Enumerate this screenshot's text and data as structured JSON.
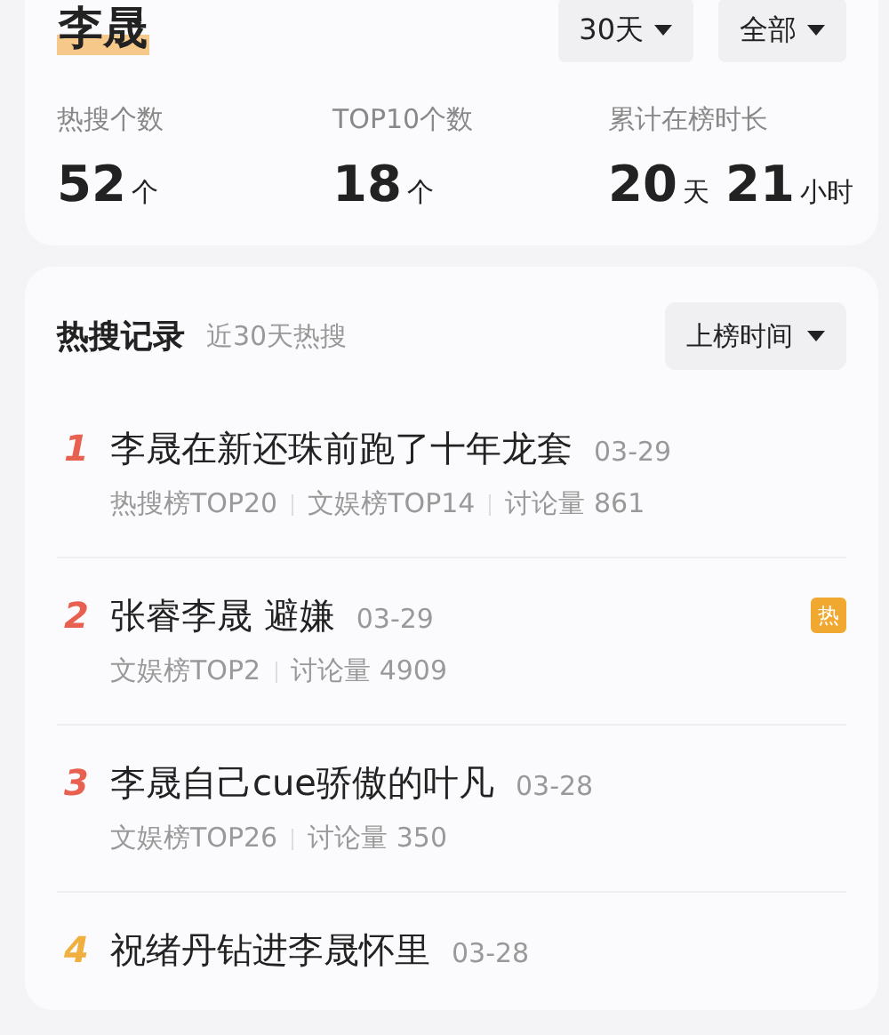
{
  "header": {
    "name": "李晟",
    "filters": [
      {
        "label": "30天"
      },
      {
        "label": "全部"
      }
    ]
  },
  "stats": [
    {
      "label": "热搜个数",
      "parts": [
        {
          "kind": "number",
          "text": "52"
        },
        {
          "kind": "unit",
          "text": "个"
        }
      ]
    },
    {
      "label": "TOP10个数",
      "parts": [
        {
          "kind": "number",
          "text": "18"
        },
        {
          "kind": "unit",
          "text": "个"
        }
      ]
    },
    {
      "label": "累计在榜时长",
      "parts": [
        {
          "kind": "number",
          "text": "20"
        },
        {
          "kind": "unit",
          "text": "天"
        },
        {
          "kind": "number",
          "text": "21"
        },
        {
          "kind": "unit",
          "text": "小时"
        }
      ]
    }
  ],
  "records": {
    "title": "热搜记录",
    "subtitle": "近30天热搜",
    "sort": "上榜时间",
    "items": [
      {
        "rank": "1",
        "color": "#e8604f",
        "title": "李晟在新还珠前跑了十年龙套",
        "date": "03-29",
        "meta": [
          "热搜榜TOP20",
          "文娱榜TOP14",
          "讨论量 861"
        ]
      },
      {
        "rank": "2",
        "color": "#e8604f",
        "title": "张睿李晟 避嫌",
        "date": "03-29",
        "badge": "热",
        "meta": [
          "文娱榜TOP2",
          "讨论量 4909"
        ]
      },
      {
        "rank": "3",
        "color": "#e8604f",
        "title": "李晟自己cue骄傲的叶凡",
        "date": "03-28",
        "meta": [
          "文娱榜TOP26",
          "讨论量 350"
        ]
      },
      {
        "rank": "4",
        "color": "#f0b040",
        "title": "祝绪丹钻进李晟怀里",
        "date": "03-28"
      }
    ]
  }
}
